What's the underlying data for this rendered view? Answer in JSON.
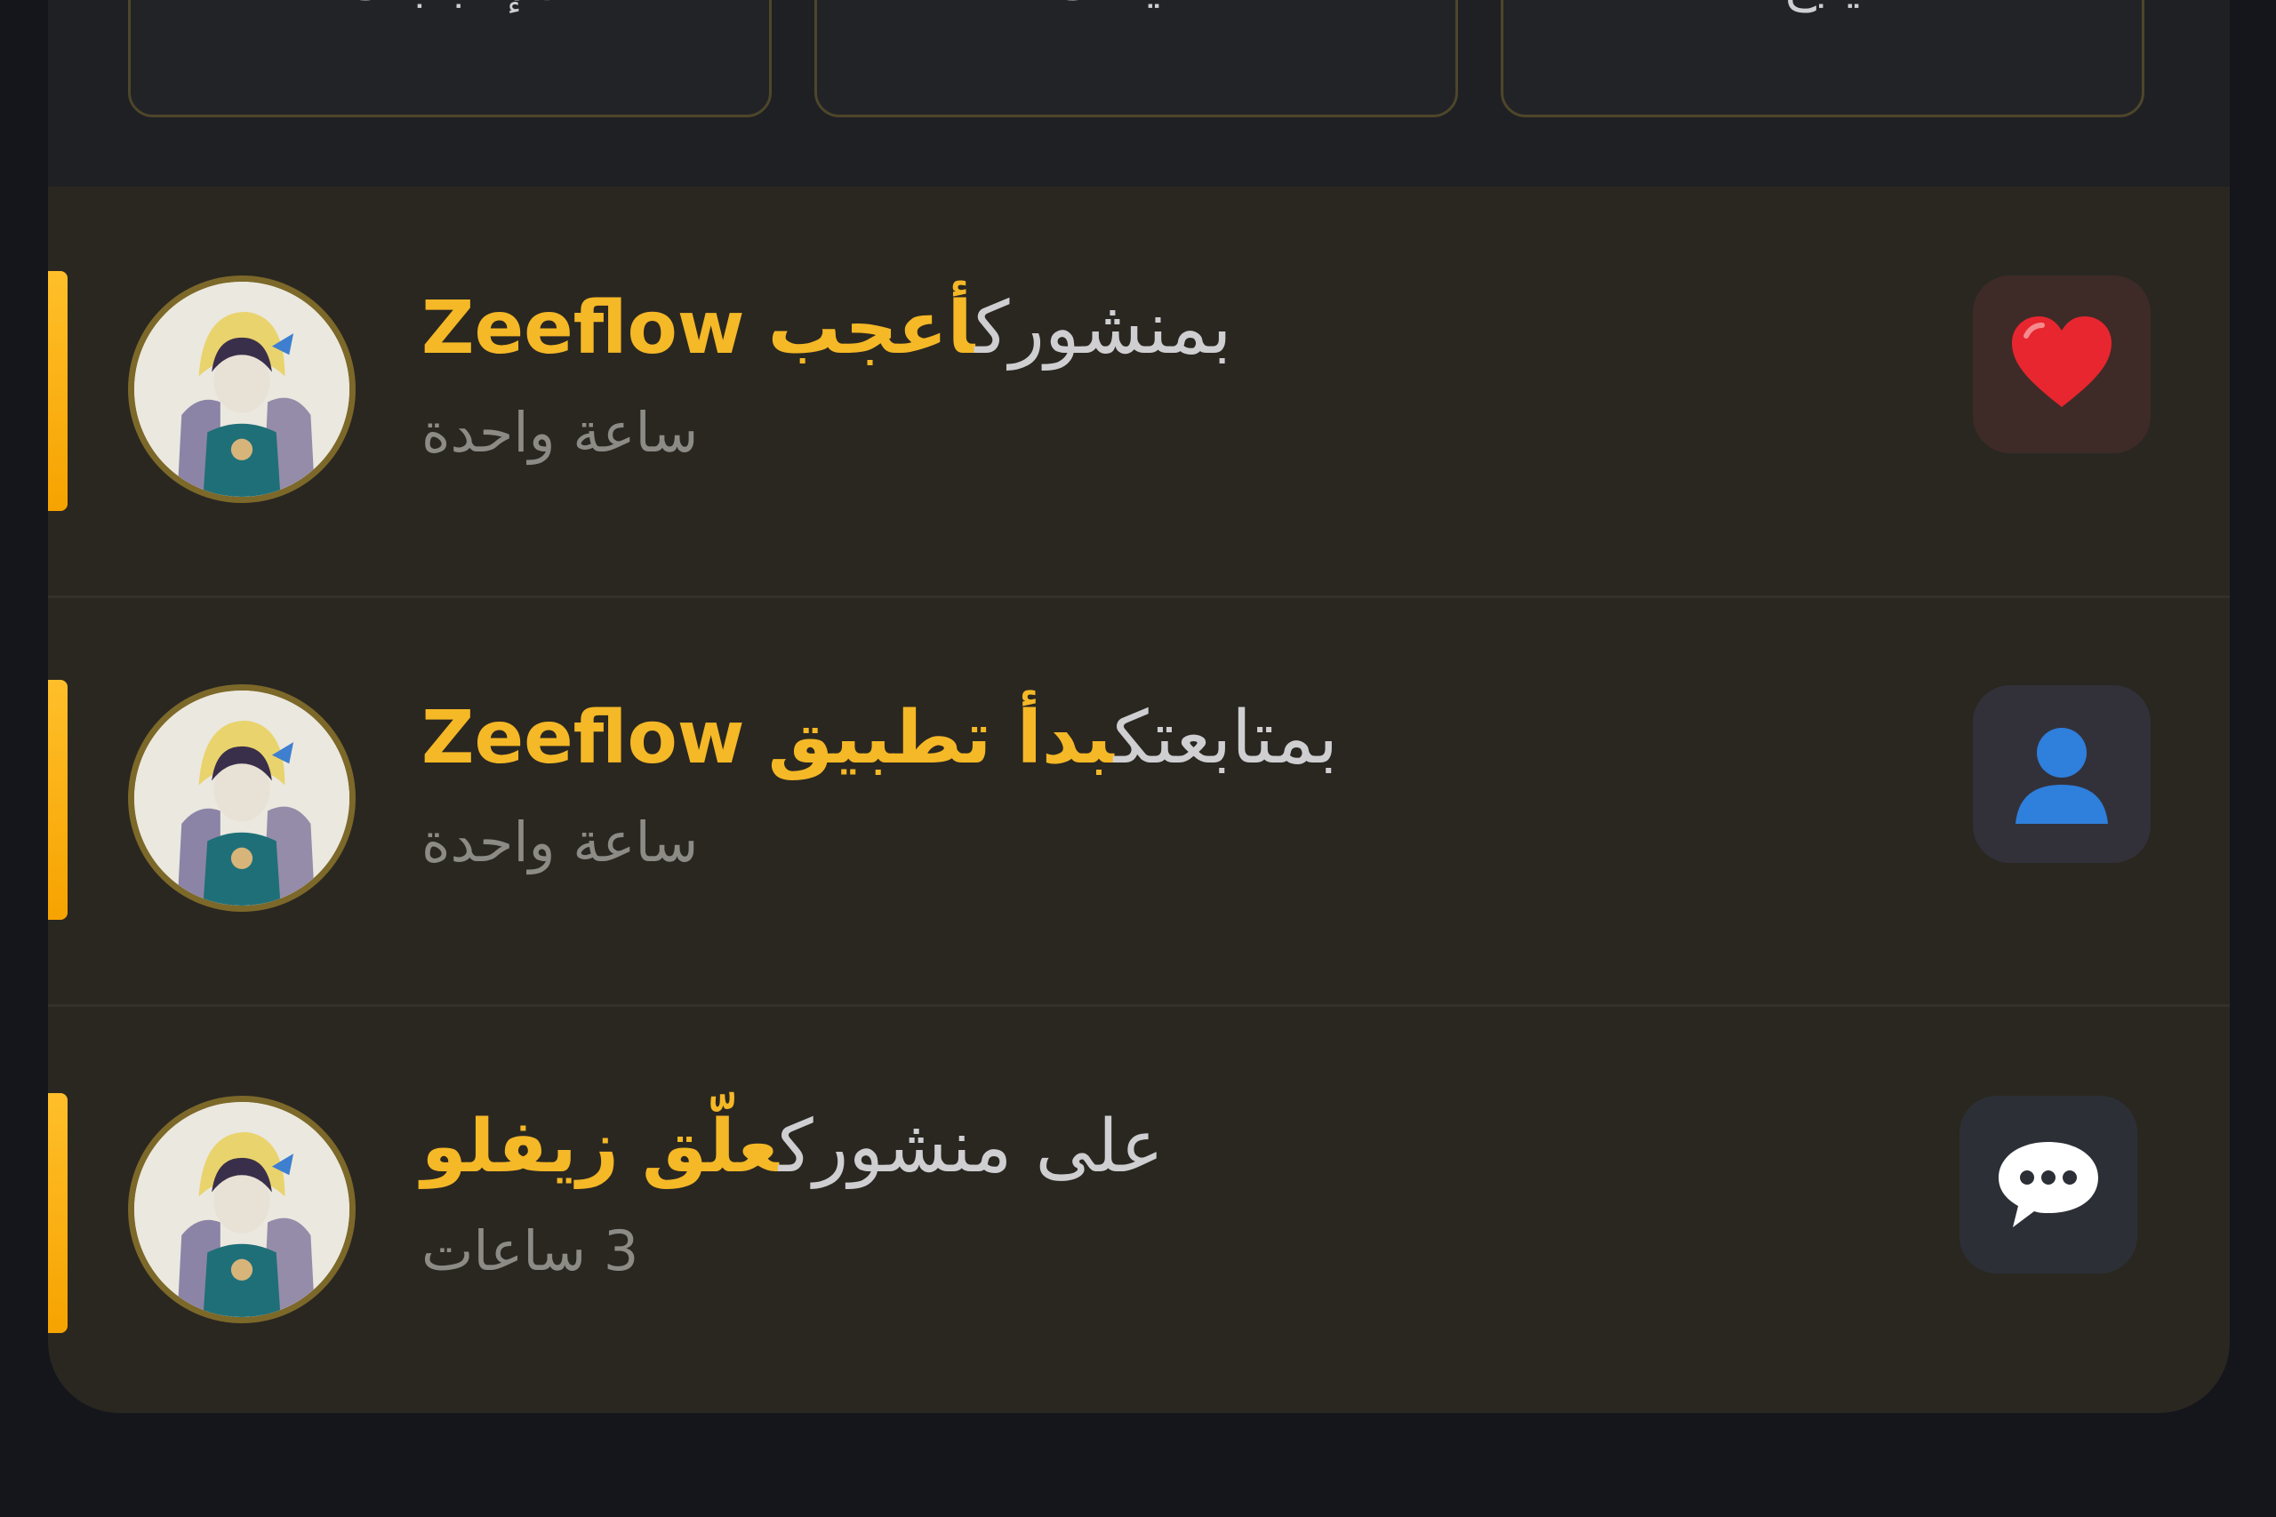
{
  "filters": {
    "likes_label": "الإعجابات",
    "comments_label": "تعليقات",
    "follows_label": "يتبع"
  },
  "notifications": [
    {
      "type_icon": "heart-icon",
      "actor": "Zeeflow",
      "action": "أعجب",
      "rest": "بمنشورك",
      "time": "ساعة واحدة",
      "unread": true
    },
    {
      "type_icon": "user-icon",
      "actor": "Zeeflow",
      "action": "بدأ تطبيق",
      "rest": "بمتابعتك",
      "time": "ساعة واحدة",
      "unread": true
    },
    {
      "type_icon": "speech-bubble-icon",
      "actor": "زيفلو",
      "action": "علّق",
      "rest": "على منشورك",
      "time": "3 ساعات",
      "unread": true
    }
  ],
  "colors": {
    "accent": "#f5b826",
    "background": "#15161b",
    "panel": "#2a2721",
    "heart": "#e8262f",
    "user": "#2f7fdc"
  }
}
